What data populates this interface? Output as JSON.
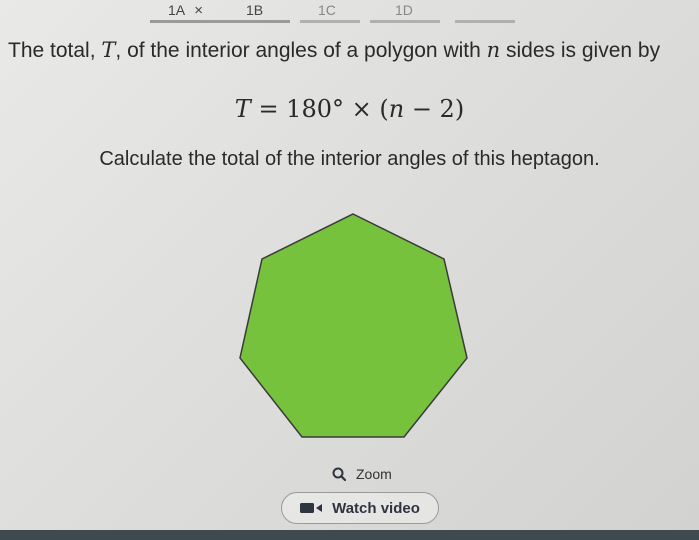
{
  "tabs": [
    {
      "label": "1A",
      "close": "×"
    },
    {
      "label": "1B"
    },
    {
      "label": "1C"
    },
    {
      "label": "1D"
    }
  ],
  "question": {
    "text_before": "The total, ",
    "var_t": "T",
    "text_mid": ", of the interior angles of a polygon with ",
    "var_n": "n",
    "text_after": " sides is given by"
  },
  "formula": {
    "lhs": "T",
    "rhs_prefix": " = 180° × (",
    "var": "n",
    "rhs_suffix": " − 2)"
  },
  "instruction": "Calculate the total of the interior angles of this heptagon.",
  "shape": {
    "type": "heptagon",
    "fill": "#77c23d",
    "stroke": "#3a3a3a"
  },
  "zoom_label": "Zoom",
  "watch_video_label": "Watch video",
  "colors": {
    "accent": "#2e3440",
    "shape_fill": "#77c23d"
  }
}
